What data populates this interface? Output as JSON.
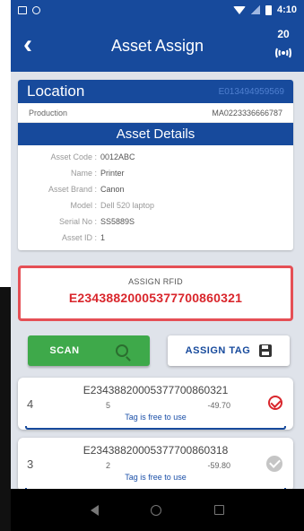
{
  "status_bar": {
    "time": "4:10"
  },
  "app_bar": {
    "title": "Asset Assign",
    "back_icon": "chevron-left-icon",
    "tag_count": "20",
    "rfid_icon": "rfid-antenna-icon"
  },
  "location": {
    "header_label": "Location",
    "epc": "E013494959569",
    "name": "Production",
    "code": "MA0223336666787"
  },
  "asset_details": {
    "header": "Asset Details",
    "rows": [
      {
        "key": "Asset Code :",
        "value": "0012ABC"
      },
      {
        "key": "Name :",
        "value": "Printer"
      },
      {
        "key": "Asset Brand :",
        "value": "Canon"
      },
      {
        "key": "Model :",
        "value": "Dell 520 laptop"
      },
      {
        "key": "Serial No :",
        "value": "SS5889S"
      },
      {
        "key": "Asset ID :",
        "value": "1"
      }
    ]
  },
  "assign_rfid": {
    "label": "ASSIGN RFID",
    "value": "E2343882000537770086032​1"
  },
  "buttons": {
    "scan_label": "SCAN",
    "assign_tag_label": "ASSIGN TAG"
  },
  "tags": [
    {
      "index": "4",
      "epc": "E234388200053777008603​21",
      "count": "5",
      "rssi": "-49.70",
      "status": "Tag is free to use",
      "selected": true
    },
    {
      "index": "3",
      "epc": "E234388200053777008603​18",
      "count": "2",
      "rssi": "-59.80",
      "status": "Tag is free to use",
      "selected": false
    }
  ],
  "colors": {
    "primary": "#174a9c",
    "accent_red": "#d9262c",
    "scan_green": "#3ea94a"
  }
}
